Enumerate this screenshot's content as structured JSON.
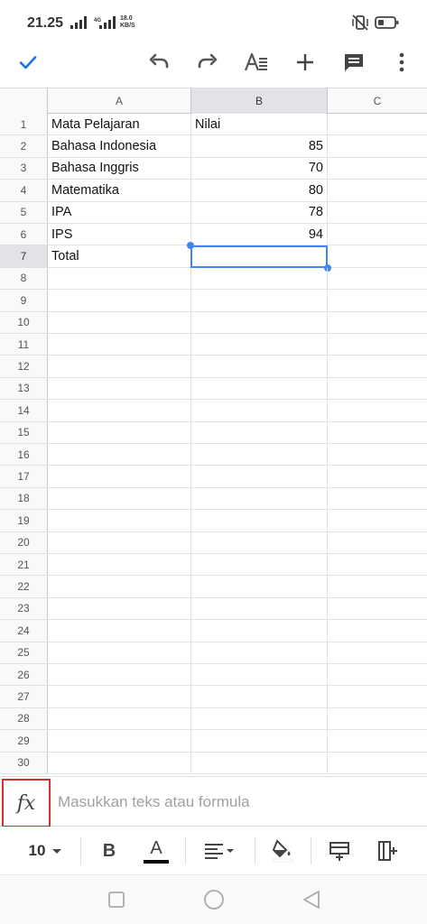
{
  "status_bar": {
    "time": "21.25",
    "network_label": "4G",
    "speed_value": "18.0",
    "speed_unit": "KB/S",
    "icons": [
      "signal-icon",
      "signal-4g-icon",
      "vibrate-off-icon",
      "battery-icon"
    ]
  },
  "toolbar": {
    "icons": [
      "check-icon",
      "undo-icon",
      "redo-icon",
      "text-format-icon",
      "add-icon",
      "comment-icon",
      "more-vert-icon"
    ],
    "accent_color": "#1a73e8"
  },
  "sheet": {
    "columns": [
      "A",
      "B",
      "C"
    ],
    "selected_column": "B",
    "selected_row": "7",
    "rows": [
      {
        "num": "1",
        "a": "Mata Pelajaran",
        "b": "Nilai"
      },
      {
        "num": "2",
        "a": "Bahasa Indonesia",
        "b": "85"
      },
      {
        "num": "3",
        "a": "Bahasa Inggris",
        "b": "70"
      },
      {
        "num": "4",
        "a": "Matematika",
        "b": "80"
      },
      {
        "num": "5",
        "a": "IPA",
        "b": "78"
      },
      {
        "num": "6",
        "a": "IPS",
        "b": "94"
      },
      {
        "num": "7",
        "a": "Total",
        "b": ""
      },
      {
        "num": "8",
        "a": "",
        "b": ""
      },
      {
        "num": "9",
        "a": "",
        "b": ""
      },
      {
        "num": "10",
        "a": "",
        "b": ""
      },
      {
        "num": "11",
        "a": "",
        "b": ""
      },
      {
        "num": "12",
        "a": "",
        "b": ""
      },
      {
        "num": "13",
        "a": "",
        "b": ""
      },
      {
        "num": "14",
        "a": "",
        "b": ""
      },
      {
        "num": "15",
        "a": "",
        "b": ""
      },
      {
        "num": "16",
        "a": "",
        "b": ""
      },
      {
        "num": "17",
        "a": "",
        "b": ""
      },
      {
        "num": "18",
        "a": "",
        "b": ""
      },
      {
        "num": "19",
        "a": "",
        "b": ""
      },
      {
        "num": "20",
        "a": "",
        "b": ""
      },
      {
        "num": "21",
        "a": "",
        "b": ""
      },
      {
        "num": "22",
        "a": "",
        "b": ""
      },
      {
        "num": "23",
        "a": "",
        "b": ""
      },
      {
        "num": "24",
        "a": "",
        "b": ""
      },
      {
        "num": "25",
        "a": "",
        "b": ""
      },
      {
        "num": "26",
        "a": "",
        "b": ""
      },
      {
        "num": "27",
        "a": "",
        "b": ""
      },
      {
        "num": "28",
        "a": "",
        "b": ""
      },
      {
        "num": "29",
        "a": "",
        "b": ""
      },
      {
        "num": "30",
        "a": "",
        "b": ""
      }
    ],
    "selection_color": "#4285f4"
  },
  "formula_bar": {
    "fx_label": "fx",
    "placeholder": "Masukkan teks atau formula",
    "highlight_color": "#d32f2f"
  },
  "format_bar": {
    "font_size": "10",
    "bold_label": "B",
    "text_color_label": "A",
    "icons": [
      "chevron-down-icon",
      "bold-icon",
      "text-color-icon",
      "align-left-icon",
      "fill-color-icon",
      "insert-row-icon",
      "insert-column-icon"
    ]
  },
  "nav_bar": {
    "icons": [
      "recent-apps-icon",
      "home-icon",
      "back-icon"
    ]
  }
}
